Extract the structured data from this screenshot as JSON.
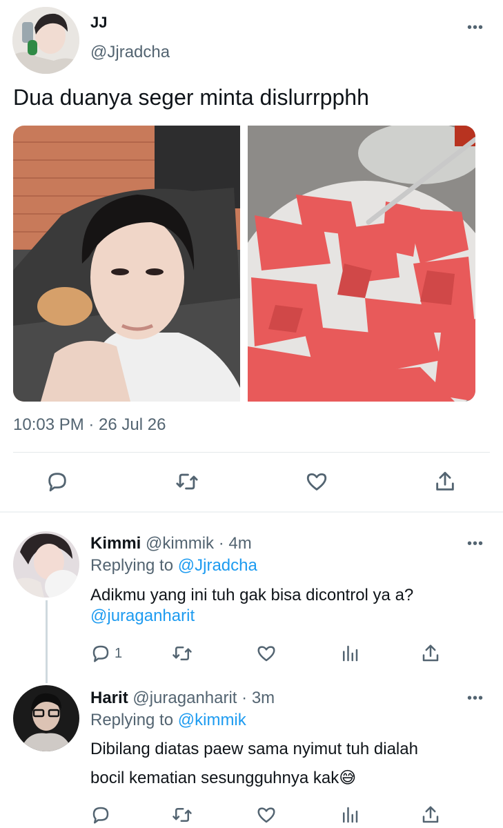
{
  "main_tweet": {
    "author_name": "JJ",
    "author_handle": "@Jjradcha",
    "text": "Dua duanya seger minta dislurrpphh",
    "timestamp": "10:03 PM · 26 Jul 26",
    "images": [
      "selfie-photo",
      "watermelon-plate-photo"
    ],
    "actions": [
      "reply-icon",
      "retweet-icon",
      "like-icon",
      "share-icon"
    ]
  },
  "replies": [
    {
      "author_name": "Kimmi",
      "author_handle": "@kimmik",
      "time": "· 4m",
      "replying_prefix": "Replying to",
      "replying_to": "@Jjradcha",
      "text": "Adikmu yang ini tuh gak bisa dicontrol ya a?",
      "mention": "@juraganharit",
      "reply_count": "1"
    },
    {
      "author_name": "Harit",
      "author_handle": "@juraganharit",
      "time": "· 3m",
      "replying_prefix": "Replying to",
      "replying_to": "@kimmik",
      "text_line1": "Dibilang diatas paew sama nyimut tuh dialah",
      "text_line2": "bocil kematian sesungguhnya kak",
      "emoji": "😅"
    }
  ],
  "colors": {
    "accent": "#1d9bf0",
    "secondary_text": "#536471",
    "divider": "#eff3f4"
  }
}
